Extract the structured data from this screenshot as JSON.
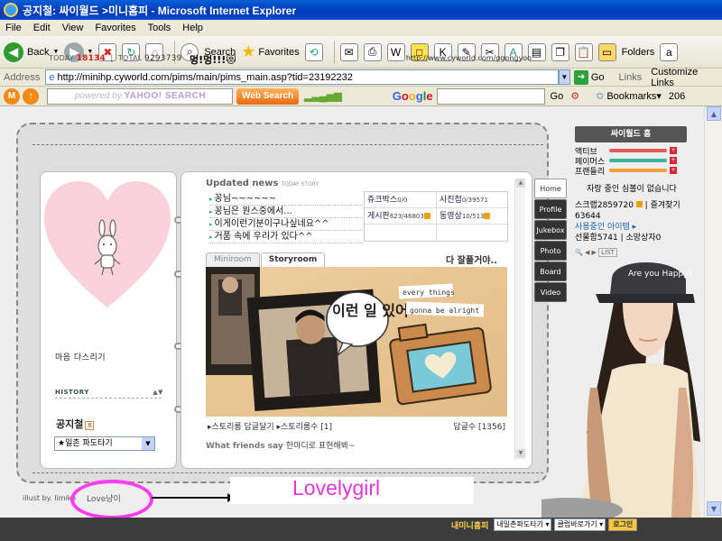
{
  "window": {
    "title": "공지철: 싸이월드 >미니홈피 - Microsoft Internet Explorer"
  },
  "menu": [
    "File",
    "Edit",
    "View",
    "Favorites",
    "Tools",
    "Help"
  ],
  "toolbar": {
    "back_label": "Back",
    "search_label": "Search",
    "favorites_label": "Favorites",
    "folders_label": "Folders"
  },
  "address": {
    "label": "Address",
    "url": "http://minihp.cyworld.com/pims/main/pims_main.asp?tid=23192232",
    "go_label": "Go",
    "links_label": "Links",
    "customize_label": "Customize Links"
  },
  "linksbar": {
    "yahoo_powered": "powered by",
    "yahoo_brand": "YAHOO! SEARCH",
    "websearch_label": "Web Search",
    "google_label": "Google",
    "google_go": "Go",
    "bookmarks_label": "Bookmarks▾",
    "right_number": "206"
  },
  "minihompy": {
    "today_label": "TODAY",
    "today_value": "18134",
    "total_label": "TOTAL",
    "total_value": "9293739",
    "title": "멍!멍!!!😻",
    "url": "http://www.cyworld.com/ggongyoo",
    "mood": "마음 다스리기",
    "history_label": "HISTORY",
    "owner_name": "공지철",
    "owner_badge": "8",
    "owner_select": "★일촌 파도타기",
    "updated_title": "Updated news",
    "updated_sub": "TODAY STORY",
    "updated_items": [
      "꽁님~~~~~~",
      "꽁님은 원스중에서...",
      "이게이런기분이구나싶네요^^",
      "거품 속에 우리가 있다^^"
    ],
    "stats": [
      {
        "label": "쥬크박스",
        "value": "0/0"
      },
      {
        "label": "사진첩",
        "value": "0/39571"
      },
      {
        "label": "게시판",
        "value": "623/46803"
      },
      {
        "label": "동영상",
        "value": "10/513"
      }
    ],
    "tabs": [
      "Miniroom",
      "Storyroom"
    ],
    "tagline": "다 잘풀거야..",
    "photo_bubble_text": "every things",
    "photo_bubble_text2": "gonna be alright",
    "photo_speech": "이런 일 있어",
    "story_reply": "스토리룸 답글달기",
    "story_count": "스토리룸수 [1]",
    "reply_count": "답글수 [1356]",
    "friends_say": "What friends say",
    "friends_say_text": "한마디로 표현해봐~",
    "menu_tabs": [
      "Home",
      "Profile",
      "Jukebox",
      "Photo",
      "Board",
      "Video"
    ],
    "illust_credit": "illust by. limiko",
    "illust_annot": "Love냥이",
    "lovelygirl": "Lovelygirl"
  },
  "cyworld_panel": {
    "header": "싸이월드 홈",
    "bars": [
      {
        "name": "액티브",
        "color": "#e65a5a"
      },
      {
        "name": "페이머스",
        "color": "#3ab5a0"
      },
      {
        "name": "프랜들리",
        "color": "#f2a33a"
      }
    ],
    "status_line": "자랑 중인 심볼이 없습니다",
    "scrap": "스크랩2859720",
    "scrap_link": "즐겨찾기",
    "scrap_count": "63644",
    "item_line": "사용중인 아이템 ▸",
    "gift_line": "선물함5741",
    "gift_link": "소망상자0"
  },
  "girl_hat_text": "Are you Happy?",
  "bottom_strip": {
    "label": "내미니홈피",
    "select1": "내일촌파도타기 ▾",
    "select2": "클럽바로가기 ▾",
    "login": "로그인"
  },
  "colors": {
    "titlebar": "#0a4bd0",
    "pink_annotation": "#ff3cf0",
    "lovely_text": "#e236d6"
  }
}
